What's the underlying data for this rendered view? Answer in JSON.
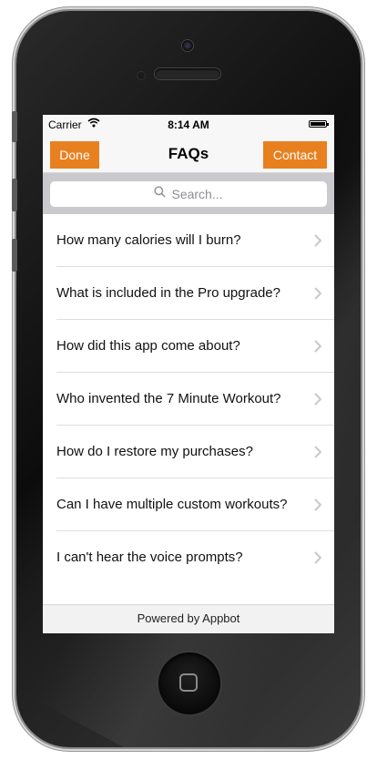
{
  "status_bar": {
    "carrier": "Carrier",
    "time": "8:14 AM"
  },
  "nav": {
    "title": "FAQs",
    "left_button": "Done",
    "right_button": "Contact"
  },
  "search": {
    "placeholder": "Search..."
  },
  "faq_items": [
    "How many calories will I burn?",
    "What is included in the Pro upgrade?",
    "How did this app come about?",
    "Who invented the 7 Minute Workout?",
    "How do I restore my purchases?",
    "Can I have multiple custom workouts?",
    "I can't hear the voice prompts?"
  ],
  "footer": {
    "text": "Powered by Appbot"
  },
  "colors": {
    "accent": "#e8801f",
    "separator": "#dedede",
    "search_bar_bg": "#c9c9ce"
  },
  "icons": {
    "search": "search-icon",
    "wifi": "wifi-icon",
    "battery": "battery-icon",
    "chevron": "chevron-right-icon"
  }
}
